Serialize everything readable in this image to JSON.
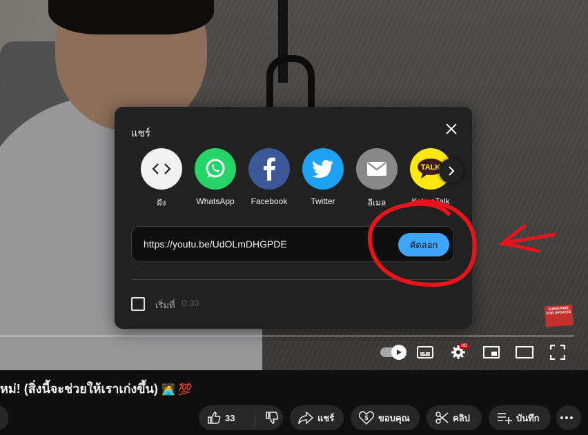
{
  "dialog": {
    "title": "แชร์",
    "targets": [
      {
        "label": "ฝัง",
        "icon": "embed-icon",
        "color": "#f1f1f1"
      },
      {
        "label": "WhatsApp",
        "icon": "whatsapp-icon",
        "color": "#25d366"
      },
      {
        "label": "Facebook",
        "icon": "facebook-icon",
        "color": "#3b5998"
      },
      {
        "label": "Twitter",
        "icon": "twitter-icon",
        "color": "#1da1f2"
      },
      {
        "label": "อีเมล",
        "icon": "email-icon",
        "color": "#888888"
      },
      {
        "label": "KakaoTalk",
        "icon": "kakaotalk-icon",
        "color": "#ffe812",
        "badge_text": "TALK"
      }
    ],
    "url": "https://youtu.be/UdOLmDHGPDE",
    "copy_label": "คัดลอก",
    "start_label": "เริ่มที่",
    "start_time": "0:30",
    "start_checked": false
  },
  "player": {
    "subscribe_badge": "SUBSCRIBE FOR UPDATES",
    "hd_badge": "HD",
    "autoplay_on": true
  },
  "video": {
    "title": "หม่! (สิ่งนี้จะช่วยให้เราเก่งขึ้น)",
    "title_emojis": "🧑‍💻 💯"
  },
  "actions": {
    "like_count": "33",
    "share_label": "แชร์",
    "thanks_label": "ขอบคุณ",
    "clip_label": "คลิป",
    "save_label": "บันทึก"
  },
  "colors": {
    "accent": "#3ea6ff",
    "annotation": "#e8141b",
    "dialog_bg": "#212121"
  }
}
